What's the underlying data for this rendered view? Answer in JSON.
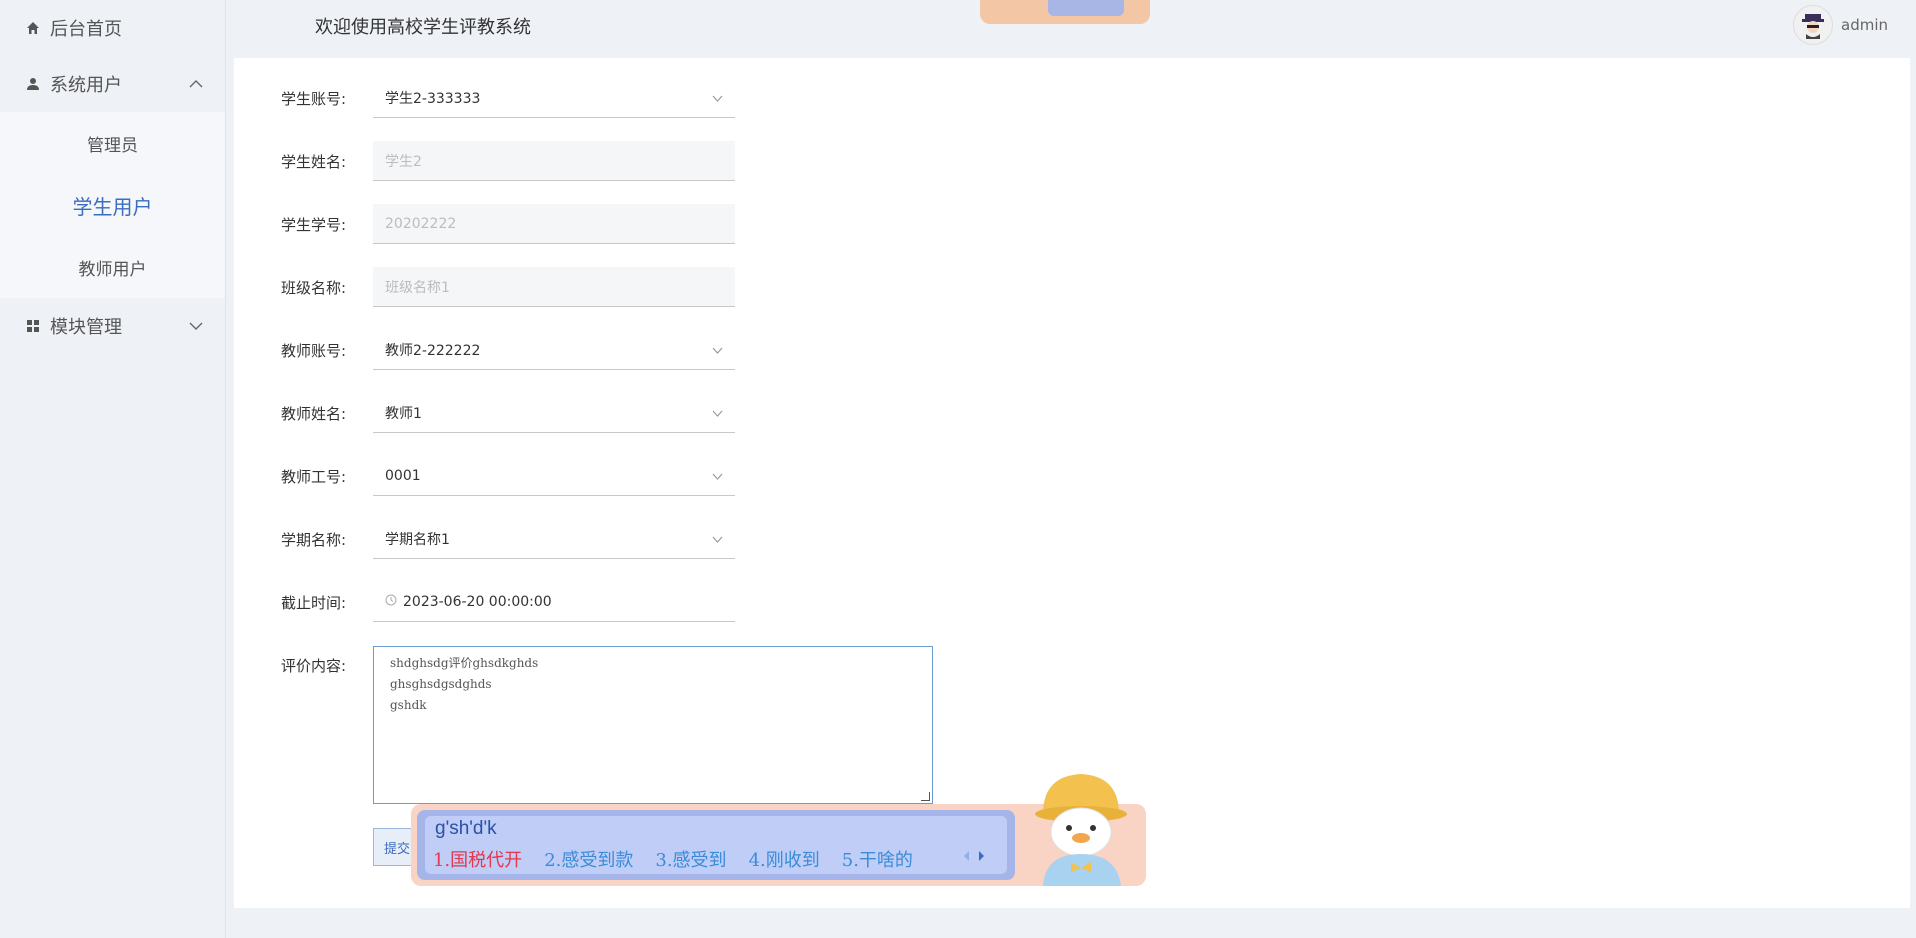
{
  "sidebar": {
    "home": "后台首页",
    "system_users": "系统用户",
    "sub_items": [
      "管理员",
      "学生用户",
      "教师用户"
    ],
    "modules": "模块管理"
  },
  "header": {
    "title": "欢迎使用高校学生评教系统",
    "username": "admin"
  },
  "form": {
    "student_account": {
      "label": "学生账号:",
      "value": "学生2-333333"
    },
    "student_name": {
      "label": "学生姓名:",
      "value": "学生2"
    },
    "student_no": {
      "label": "学生学号:",
      "value": "20202222"
    },
    "class_name": {
      "label": "班级名称:",
      "value": "班级名称1"
    },
    "teacher_account": {
      "label": "教师账号:",
      "value": "教师2-222222"
    },
    "teacher_name": {
      "label": "教师姓名:",
      "value": "教师1"
    },
    "teacher_no": {
      "label": "教师工号:",
      "value": "0001"
    },
    "term_name": {
      "label": "学期名称:",
      "value": "学期名称1"
    },
    "deadline": {
      "label": "截止时间:",
      "value": "2023-06-20 00:00:00"
    },
    "evaluation": {
      "label": "评价内容:",
      "lines": [
        "shdghsdg评价ghsdkghds",
        "ghsghsdgsdghds",
        "gshdk"
      ]
    },
    "submit": "提交"
  },
  "ime": {
    "composition": "g'sh'd'k",
    "candidates": [
      "1.国税代开",
      "2.感受到款",
      "3.感受到",
      "4.刚收到",
      "5.干啥的"
    ]
  }
}
